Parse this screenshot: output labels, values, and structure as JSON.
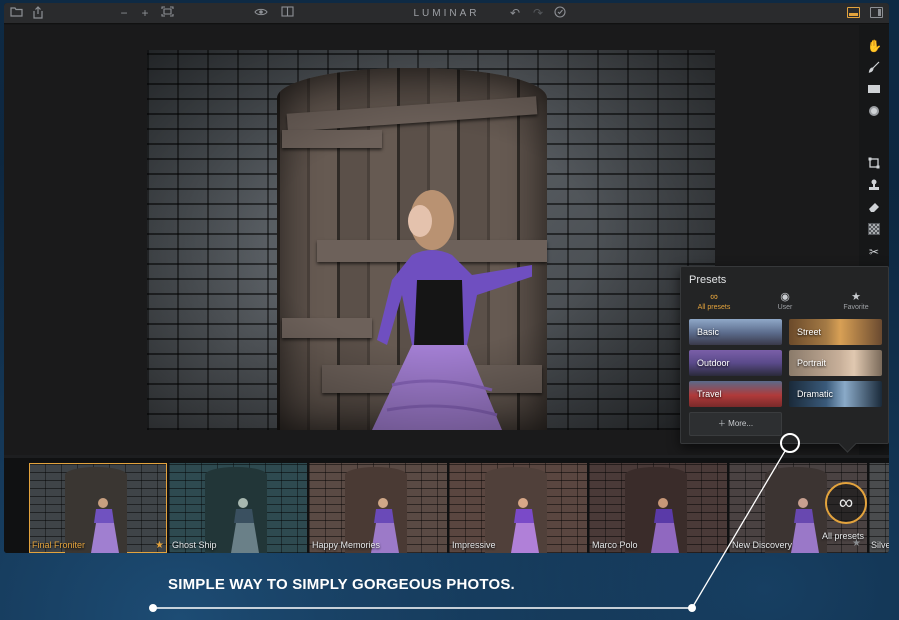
{
  "app": {
    "title": "LUMINAR",
    "accent_color": "#e3a33d",
    "toolbar_left_icons": [
      "folder-icon",
      "share-icon",
      "zoom-out-icon",
      "zoom-in-icon",
      "fit-screen-icon"
    ],
    "toolbar_center_icons": [
      "preview-eye-icon",
      "compare-icon"
    ],
    "toolbar_right_icons": [
      "undo-icon",
      "redo-icon",
      "history-icon"
    ],
    "layout_icons": [
      "filmstrip-layout-icon",
      "sidebar-layout-icon"
    ]
  },
  "tools": [
    "hand-icon",
    "brush-icon",
    "gradient-mask-icon",
    "radial-mask-icon",
    "crop-icon",
    "clone-stamp-icon",
    "eraser-icon",
    "noise-icon",
    "transform-icon"
  ],
  "presets_panel": {
    "title": "Presets",
    "tabs": [
      {
        "label": "All presets",
        "icon": "infinity-icon",
        "active": true
      },
      {
        "label": "User",
        "icon": "user-icon",
        "active": false
      },
      {
        "label": "Favorite",
        "icon": "star-icon",
        "active": false
      }
    ],
    "categories": [
      "Basic",
      "Street",
      "Outdoor",
      "Portrait",
      "Travel",
      "Dramatic"
    ],
    "more_label": "More..."
  },
  "filmstrip": {
    "presets": [
      {
        "name": "Final Froniter",
        "selected": true,
        "favorite": true
      },
      {
        "name": "Ghost Ship",
        "selected": false,
        "favorite": false
      },
      {
        "name": "Happy Memories",
        "selected": false,
        "favorite": false
      },
      {
        "name": "Impressive",
        "selected": false,
        "favorite": false
      },
      {
        "name": "Marco Polo",
        "selected": false,
        "favorite": false
      },
      {
        "name": "New Discovery",
        "selected": false,
        "favorite": false
      },
      {
        "name": "Silver",
        "selected": false,
        "favorite": true
      }
    ],
    "all_presets_label": "All presets"
  },
  "tagline": "SIMPLE WAY TO SIMPLY GORGEOUS PHOTOS."
}
